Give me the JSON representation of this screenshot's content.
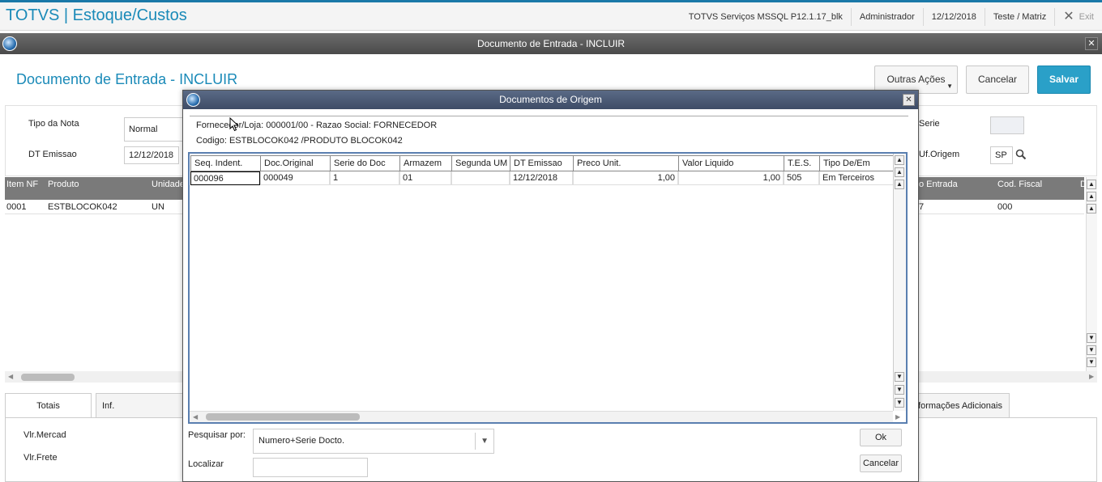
{
  "app": {
    "title": "TOTVS | Estoque/Custos",
    "server": "TOTVS Serviços MSSQL P12.1.17_blk",
    "user": "Administrador",
    "date": "12/12/2018",
    "branch": "Teste / Matriz",
    "exit_label": "Exit"
  },
  "window": {
    "title": "Documento de Entrada - INCLUIR"
  },
  "page": {
    "title": "Documento de Entrada - INCLUIR",
    "buttons": {
      "more": "Outras Ações",
      "cancel": "Cancelar",
      "save": "Salvar"
    }
  },
  "form": {
    "tipo_nota_label": "Tipo da Nota",
    "tipo_nota_value": "Normal",
    "dt_emissao_label": "DT Emissao",
    "dt_emissao_value": "12/12/2018",
    "serie_label": "Serie",
    "uf_origem_label": "Uf.Origem",
    "uf_origem_value": "SP"
  },
  "items_grid": {
    "columns": [
      "Item NF",
      "Produto",
      "Unidade",
      "o Entrada",
      "Cod. Fiscal",
      "D"
    ],
    "row": [
      "0001",
      "ESTBLOCOK042",
      "UN",
      "7",
      "000"
    ]
  },
  "tabs": [
    "Totais",
    "Inf. Fornecedor/Clien",
    "formações Adicionais"
  ],
  "totals": {
    "vlr_mercad": "Vlr.Mercad",
    "vlr_frete": "Vlr.Frete"
  },
  "modal": {
    "title": "Documentos de Origem",
    "fornecedor_line": "Fornecedor/Loja: 000001/00  -  Razao Social: FORNECEDOR",
    "codigo_line": "Codigo: ESTBLOCOK042   /PRODUTO BLOCOK042",
    "columns": [
      "Seq. Indent.",
      "Doc.Original",
      "Serie do Doc",
      "Armazem",
      "Segunda UM",
      "DT Emissao",
      "Preco Unit.",
      "Valor Liquido",
      "T.E.S.",
      "Tipo De/Em"
    ],
    "rows": [
      [
        "000096",
        "000049",
        "1",
        "01",
        "",
        "12/12/2018",
        "1,00",
        "1,00",
        "505",
        "Em Terceiros"
      ]
    ],
    "search_label": "Pesquisar por:",
    "search_value": "Numero+Serie Docto.",
    "locate_label": "Localizar",
    "ok_label": "Ok",
    "cancel_label": "Cancelar"
  }
}
